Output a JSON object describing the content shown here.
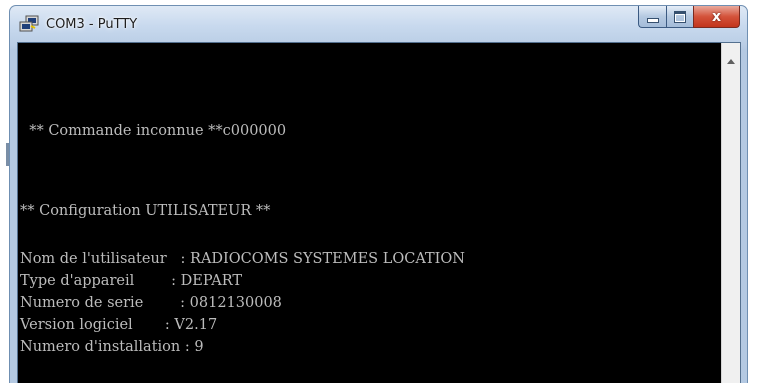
{
  "window": {
    "title": "COM3 - PuTTY",
    "icon": "putty-icon",
    "buttons": {
      "minimize": "minimize-icon",
      "maximize": "maximize-icon",
      "close": "close-icon",
      "close_glyph": "x"
    }
  },
  "terminal": {
    "lines": [
      "  ** Commande inconnue **c000000",
      "** Configuration UTILISATEUR **",
      "Nom de l'utilisateur   : RADIOCOMS SYSTEMES LOCATION",
      "Type d'appareil        : DEPART",
      "Numero de serie        : 0812130008",
      "Version logiciel       : V2.17",
      "Numero d'installation : 9"
    ]
  },
  "colors": {
    "terminal_background": "#000000",
    "terminal_text": "#bcbcbc",
    "titlebar": "#c8d9ee",
    "close_button": "#d4533b"
  }
}
